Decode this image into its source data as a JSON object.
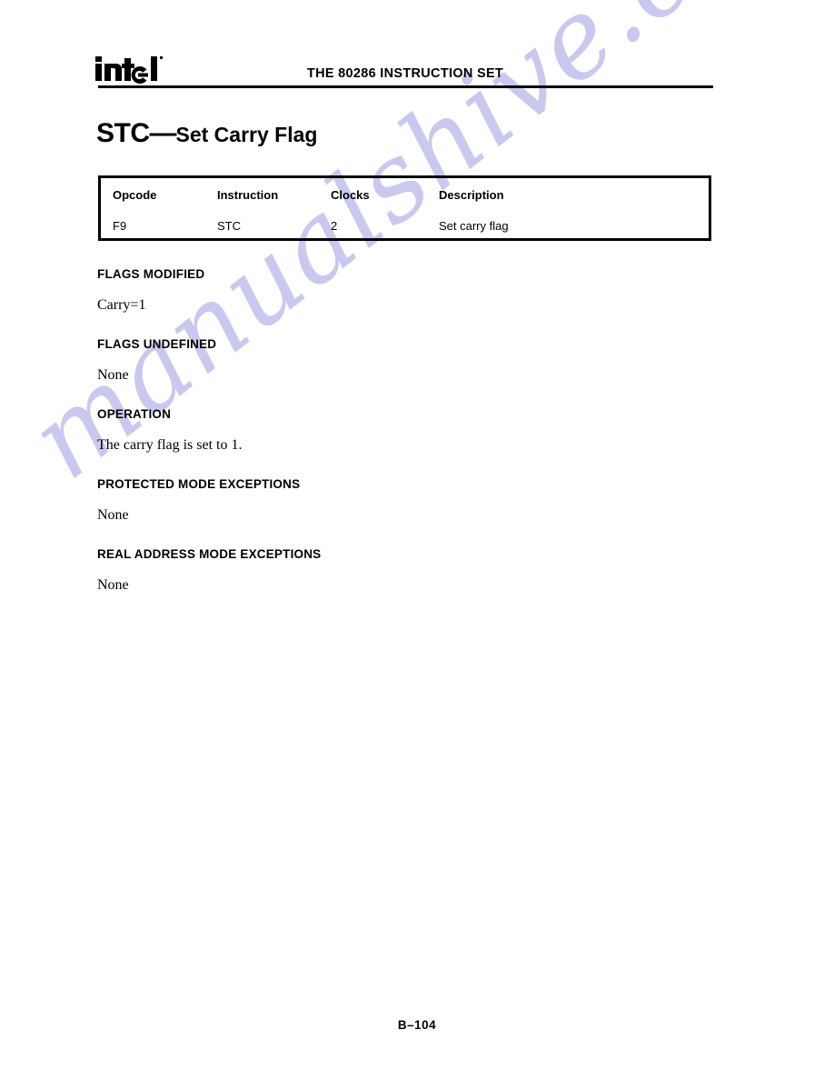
{
  "header": {
    "logo_text": "intel",
    "logo_name": "intel-logo",
    "title": "THE 80286 INSTRUCTION SET"
  },
  "instruction": {
    "mnemonic": "STC",
    "dash": "—",
    "name": "Set Carry Flag"
  },
  "opcode_table": {
    "columns": [
      "Opcode",
      "Instruction",
      "Clocks",
      "Description"
    ],
    "rows": [
      {
        "opcode": "F9",
        "instruction": "STC",
        "clocks": "2",
        "description": "Set carry flag"
      }
    ]
  },
  "sections": [
    {
      "heading": "FLAGS MODIFIED",
      "body": "Carry=1"
    },
    {
      "heading": "FLAGS UNDEFINED",
      "body": "None"
    },
    {
      "heading": "OPERATION",
      "body": "The carry flag is set to 1."
    },
    {
      "heading": "PROTECTED MODE EXCEPTIONS",
      "body": "None"
    },
    {
      "heading": "REAL ADDRESS MODE EXCEPTIONS",
      "body": "None"
    }
  ],
  "footer": {
    "page_number": "B–104"
  },
  "watermark": {
    "text": "manualshive.com",
    "color": "#c9c9ef"
  }
}
